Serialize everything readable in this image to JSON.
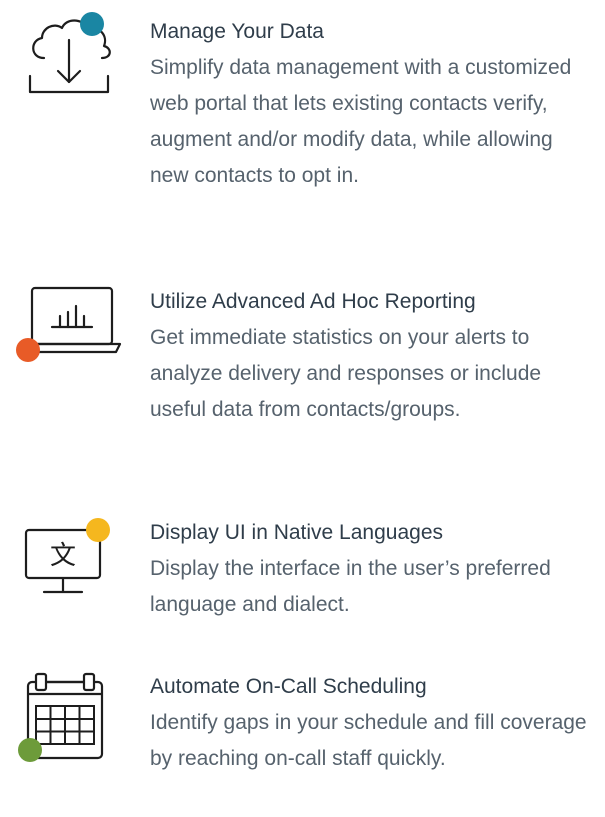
{
  "features": [
    {
      "icon": "cloud-download-icon",
      "accent": "#1a86a3",
      "title": "Manage Your Data",
      "description": "Simplify data management with a customized web portal that lets existing contacts verify, augment and/or modify data, while allowing new contacts to opt in."
    },
    {
      "icon": "laptop-chart-icon",
      "accent": "#e85b27",
      "title": "Utilize Advanced Ad Hoc Reporting",
      "description": "Get immediate statistics on your alerts to analyze delivery and responses or include useful data from contacts/groups."
    },
    {
      "icon": "monitor-language-icon",
      "accent": "#f5b71e",
      "title": "Display UI in Native Languages",
      "description": "Display the interface in the user’s preferred language and dialect."
    },
    {
      "icon": "calendar-icon",
      "accent": "#6d9b3a",
      "title": "Automate On-Call Scheduling",
      "description": "Identify gaps in your schedule and fill coverage by reaching on-call staff quickly."
    }
  ],
  "icon_glyphs": {
    "language": "文"
  }
}
